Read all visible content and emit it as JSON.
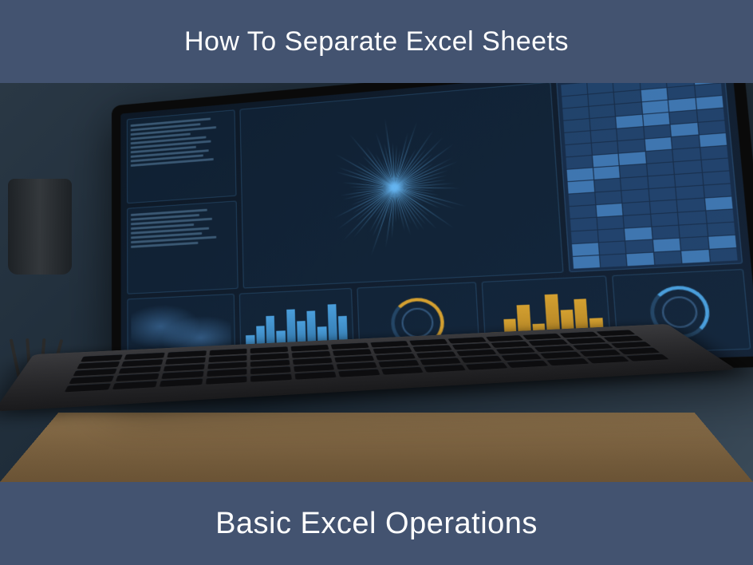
{
  "header": {
    "title": "How To Separate Excel Sheets"
  },
  "footer": {
    "title": "Basic Excel Operations"
  },
  "colors": {
    "banner": "#435370",
    "accent_blue": "#4a9edb",
    "accent_gold": "#d4a030"
  }
}
